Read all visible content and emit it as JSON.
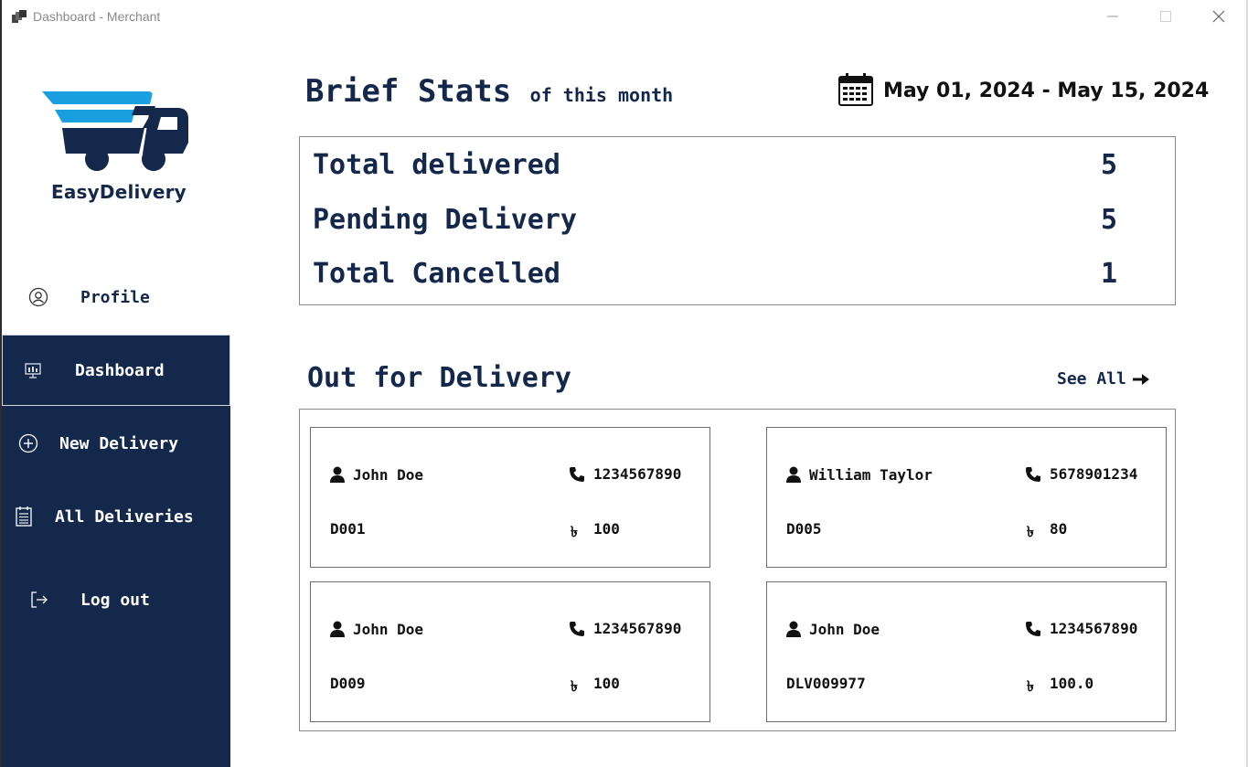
{
  "window": {
    "title": "Dashboard - Merchant"
  },
  "brand": {
    "name": "EasyDelivery",
    "colors": {
      "primary": "#14284b",
      "accent": "#1aa0e0"
    }
  },
  "sidebar": {
    "items": [
      {
        "label": "Profile",
        "icon": "user-circle-icon"
      },
      {
        "label": "Dashboard",
        "icon": "monitor-icon",
        "active": true
      },
      {
        "label": "New Delivery",
        "icon": "plus-circle-icon"
      },
      {
        "label": "All Deliveries",
        "icon": "list-icon"
      },
      {
        "label": "Log out",
        "icon": "logout-icon"
      }
    ]
  },
  "brief_stats": {
    "title": "Brief Stats",
    "subtitle": "of this month",
    "date_range": "May 01, 2024 - May 15, 2024",
    "rows": [
      {
        "label": "Total delivered",
        "value": "5"
      },
      {
        "label": "Pending Delivery",
        "value": "5"
      },
      {
        "label": "Total Cancelled",
        "value": "1"
      }
    ]
  },
  "out_for_delivery": {
    "title": "Out for Delivery",
    "see_all": "See All",
    "currency_symbol": "৳",
    "cards": [
      {
        "name": "John Doe",
        "phone": "1234567890",
        "id": "D001",
        "amount": "100"
      },
      {
        "name": "William Taylor",
        "phone": "5678901234",
        "id": "D005",
        "amount": "80"
      },
      {
        "name": "John Doe",
        "phone": "1234567890",
        "id": "D009",
        "amount": "100"
      },
      {
        "name": "John Doe",
        "phone": "1234567890",
        "id": "DLV009977",
        "amount": "100.0"
      }
    ]
  }
}
